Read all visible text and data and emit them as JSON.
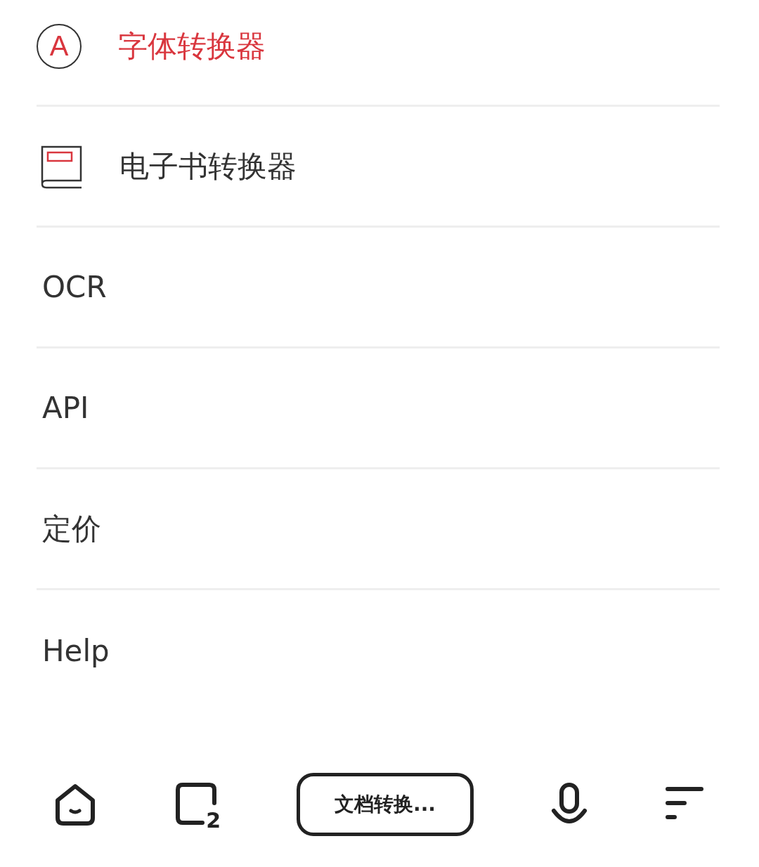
{
  "menu": [
    {
      "label": "字体转换器",
      "kind": "font",
      "selected": true,
      "icon_text": "A"
    },
    {
      "label": "电子书转换器",
      "kind": "book",
      "selected": false
    },
    {
      "label": "OCR",
      "kind": "text",
      "selected": false
    },
    {
      "label": "API",
      "kind": "text",
      "selected": false
    },
    {
      "label": "定价",
      "kind": "text",
      "selected": false
    },
    {
      "label": "Help",
      "kind": "text",
      "selected": false
    }
  ],
  "bottom_bar": {
    "tab_count": "2",
    "address": "文档转换..."
  }
}
